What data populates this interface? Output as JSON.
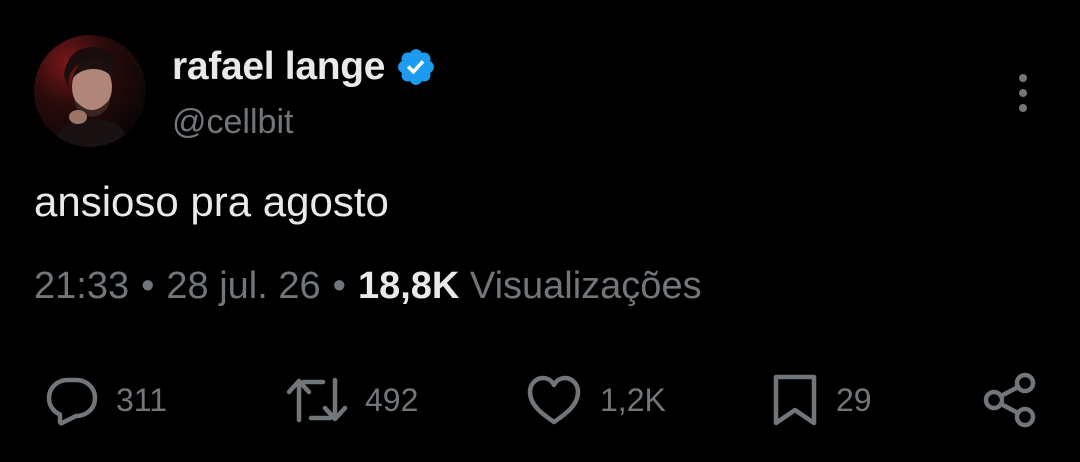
{
  "author": {
    "display_name": "rafael lange",
    "handle": "@cellbit",
    "verified": true,
    "verified_color": "#1d9bf0",
    "avatar_icon": "profile-photo"
  },
  "tweet": {
    "text": "ansioso pra agosto",
    "time": "21:33",
    "date": "28 jul. 26",
    "separator": "•",
    "views_count": "18,8K",
    "views_label": "Visualizações"
  },
  "actions": {
    "replies": "311",
    "retweets": "492",
    "likes": "1,2K",
    "bookmarks": "29"
  },
  "colors": {
    "background": "#000000",
    "primary_text": "#e7e9ea",
    "secondary_text": "#71767b"
  }
}
